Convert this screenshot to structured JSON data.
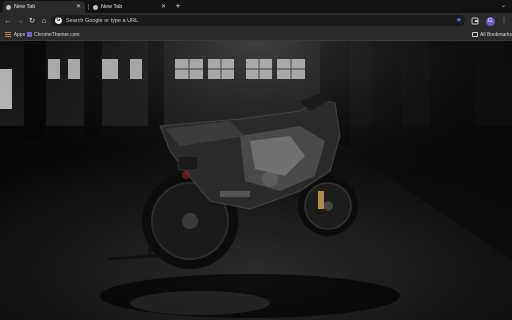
{
  "tabs": [
    {
      "title": "New Tab",
      "active": true
    },
    {
      "title": "New Tab",
      "active": false
    }
  ],
  "toolbar": {
    "omnibox_placeholder": "Search Google or type a URL",
    "search_engine_glyph": "G"
  },
  "profile": {
    "initial": "G"
  },
  "bookmarks": {
    "apps_label": "Apps",
    "items": [
      {
        "label": "ChromeThemer.com"
      }
    ],
    "all_bookmarks_label": "All Bookmarks"
  },
  "colors": {
    "accent": "#4a7cf0",
    "profile": "#6f5ac9",
    "frame": "#121212",
    "toolbar": "#2a2a2a"
  },
  "icons": [
    "back-arrow-icon",
    "forward-arrow-icon",
    "reload-icon",
    "home-icon",
    "google-icon",
    "star-icon",
    "extensions-icon",
    "menu-icon",
    "apps-grid-icon",
    "folder-icon",
    "close-icon",
    "new-tab-icon"
  ]
}
